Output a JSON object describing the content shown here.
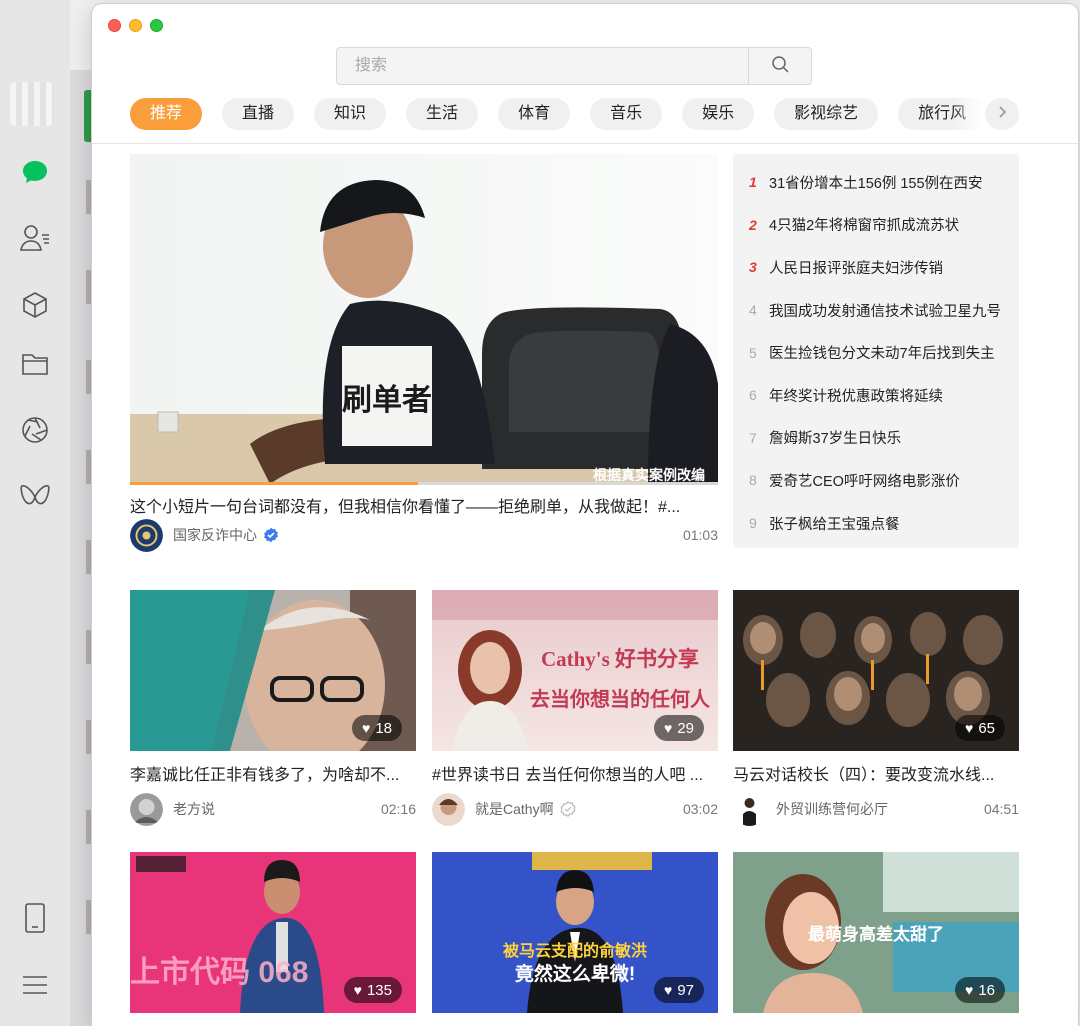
{
  "search": {
    "placeholder": "搜索"
  },
  "tabs": [
    "推荐",
    "直播",
    "知识",
    "生活",
    "体育",
    "音乐",
    "娱乐",
    "影视综艺",
    "旅行风"
  ],
  "active_tab": 0,
  "featured": {
    "overlay_label": "刷单者",
    "caption": "根据真实案例改编",
    "progress": 0.49,
    "title": "这个小短片一句台词都没有，但我相信你看懂了——拒绝刷单，从我做起！#...",
    "author": "国家反诈中心",
    "verified": true,
    "duration": "01:03"
  },
  "hot_list": [
    {
      "rank": "1",
      "text": "31省份增本土156例 155例在西安"
    },
    {
      "rank": "2",
      "text": "4只猫2年将棉窗帘抓成流苏状"
    },
    {
      "rank": "3",
      "text": "人民日报评张庭夫妇涉传销"
    },
    {
      "rank": "4",
      "text": "我国成功发射通信技术试验卫星九号"
    },
    {
      "rank": "5",
      "text": "医生捡钱包分文未动7年后找到失主"
    },
    {
      "rank": "6",
      "text": "年终奖计税优惠政策将延续"
    },
    {
      "rank": "7",
      "text": "詹姆斯37岁生日快乐"
    },
    {
      "rank": "8",
      "text": "爱奇艺CEO呼吁网络电影涨价"
    },
    {
      "rank": "9",
      "text": "张子枫给王宝强点餐"
    }
  ],
  "row1": [
    {
      "likes": "18",
      "title": "李嘉诚比任正非有钱多了，为啥却不...",
      "author": "老方说",
      "duration": "02:16"
    },
    {
      "likes": "29",
      "title": "#世界读书日 去当任何你想当的人吧 ...",
      "author": "就是Cathy啊",
      "duration": "03:02",
      "thumb_text_1": "Cathy's 好书分享",
      "thumb_text_2": "去当你想当的任何人"
    },
    {
      "likes": "65",
      "title": "马云对话校长（四）：要改变流水线...",
      "author": "外贸训练营何必厅",
      "duration": "04:51"
    }
  ],
  "row2": [
    {
      "likes": "135",
      "thumb_text": "上市代码 068"
    },
    {
      "likes": "97",
      "thumb_text_1": "被马云支配的俞敏洪",
      "thumb_text_2": "竟然这么卑微!"
    },
    {
      "likes": "16",
      "thumb_text": "最萌身高差太甜了"
    }
  ],
  "colors": {
    "accent": "#fa9d3b",
    "hot_rank": "#e53935",
    "wechat_green": "#07c160"
  }
}
